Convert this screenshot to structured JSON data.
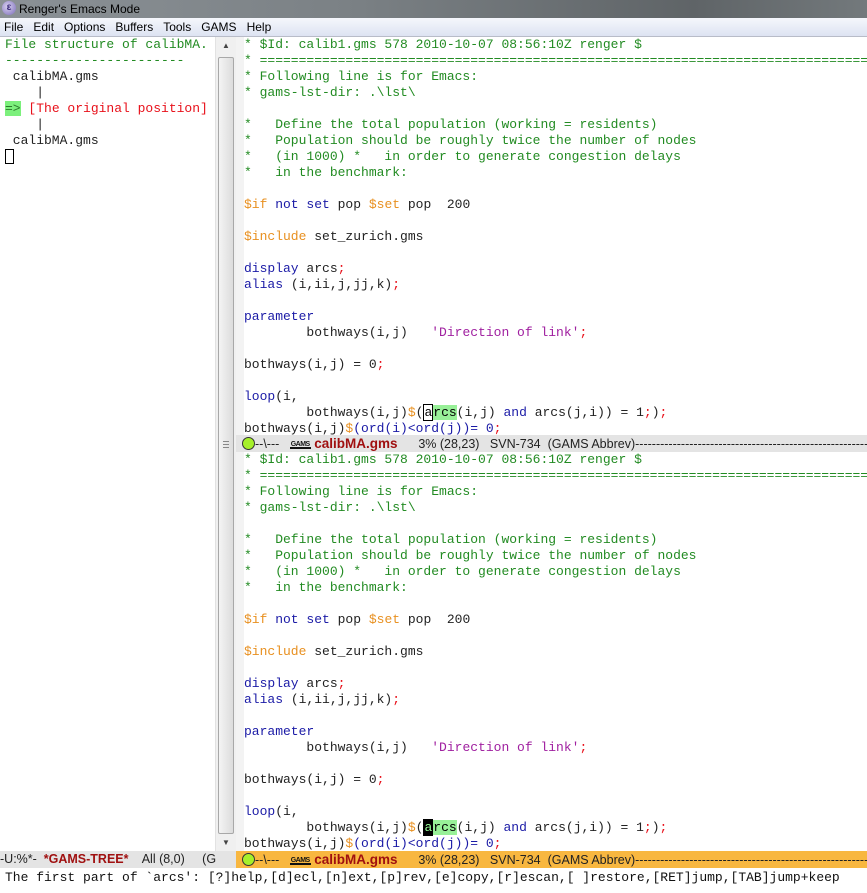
{
  "window": {
    "title": "Renger's Emacs Mode",
    "app_icon": "emacs-icon"
  },
  "menu": [
    "File",
    "Edit",
    "Options",
    "Buffers",
    "Tools",
    "GAMS",
    "Help"
  ],
  "tree": {
    "header": "File structure of calibMA.",
    "rule": "-----------------------",
    "items": [
      {
        "text": " calibMA.gms"
      },
      {
        "text": "    |"
      },
      {
        "marker": "=>",
        "text": " [The original position]"
      },
      {
        "text": "    |"
      },
      {
        "text": " calibMA.gms"
      }
    ]
  },
  "code_lines": [
    [
      {
        "t": "* $Id: calib1.gms 578 2010-10-07 08:56:10Z renger $",
        "c": "cmt"
      }
    ],
    [
      {
        "t": "* =======================================================================================",
        "c": "cmt"
      }
    ],
    [
      {
        "t": "* Following line is for Emacs:",
        "c": "cmt"
      }
    ],
    [
      {
        "t": "* gams-lst-dir: .\\lst\\",
        "c": "cmt"
      }
    ],
    [
      {
        "t": "",
        "c": "plain"
      }
    ],
    [
      {
        "t": "*   Define the total population (working = residents)",
        "c": "cmt"
      }
    ],
    [
      {
        "t": "*   Population should be roughly twice the number of nodes",
        "c": "cmt"
      }
    ],
    [
      {
        "t": "*   (in 1000) *   in order to generate congestion delays",
        "c": "cmt"
      }
    ],
    [
      {
        "t": "*   in the benchmark:",
        "c": "cmt"
      }
    ],
    [
      {
        "t": "",
        "c": "plain"
      }
    ],
    [
      {
        "t": "$if",
        "c": "dir"
      },
      {
        "t": " not set",
        "c": "kw"
      },
      {
        "t": " pop ",
        "c": "plain"
      },
      {
        "t": "$set",
        "c": "dir"
      },
      {
        "t": " pop  200",
        "c": "plain"
      }
    ],
    [
      {
        "t": "",
        "c": "plain"
      }
    ],
    [
      {
        "t": "$include",
        "c": "dir"
      },
      {
        "t": " set_zurich.gms",
        "c": "plain"
      }
    ],
    [
      {
        "t": "",
        "c": "plain"
      }
    ],
    [
      {
        "t": "display",
        "c": "kw"
      },
      {
        "t": " arcs",
        "c": "plain"
      },
      {
        "t": ";",
        "c": "semi"
      }
    ],
    [
      {
        "t": "alias",
        "c": "kw"
      },
      {
        "t": " (i,ii,j,jj,k)",
        "c": "plain"
      },
      {
        "t": ";",
        "c": "semi"
      }
    ],
    [
      {
        "t": "",
        "c": "plain"
      }
    ],
    [
      {
        "t": "parameter",
        "c": "kw"
      }
    ],
    [
      {
        "t": "        bothways(i,j)   ",
        "c": "plain"
      },
      {
        "t": "'Direction of link'",
        "c": "str"
      },
      {
        "t": ";",
        "c": "semi"
      }
    ],
    [
      {
        "t": "",
        "c": "plain"
      }
    ],
    [
      {
        "t": "bothways(i,j) = 0",
        "c": "plain"
      },
      {
        "t": ";",
        "c": "semi"
      }
    ],
    [
      {
        "t": "",
        "c": "plain"
      }
    ],
    [
      {
        "t": "loop",
        "c": "kw"
      },
      {
        "t": "(i,",
        "c": "plain"
      }
    ],
    [
      {
        "t": "        bothways(i,j)",
        "c": "plain"
      },
      {
        "t": "$",
        "c": "dir"
      },
      {
        "t": "(",
        "c": "plain"
      },
      {
        "t": "a",
        "c": "cursor"
      },
      {
        "t": "rcs",
        "c": "match"
      },
      {
        "t": "(i,j) ",
        "c": "plain"
      },
      {
        "t": "and",
        "c": "kw"
      },
      {
        "t": " arcs(j,i)) = 1",
        "c": "plain"
      },
      {
        "t": ";",
        "c": "semi"
      },
      {
        "t": ")",
        "c": "plain"
      },
      {
        "t": ";",
        "c": "semi"
      }
    ],
    [
      {
        "t": "bothways(i,j)",
        "c": "plain"
      },
      {
        "t": "$",
        "c": "dir"
      },
      {
        "t": "(ord(i)<ord(j))= 0",
        "c": "kw"
      },
      {
        "t": ";",
        "c": "semi"
      }
    ]
  ],
  "modeline_upper": {
    "status": "--\\---",
    "mode_icon": "GAMS",
    "buffer": "calibMA.gms",
    "position": "3% (28,23)",
    "vc": "SVN-734",
    "modes": "(GAMS Abbrev)"
  },
  "modeline_lower": {
    "status": "--\\---",
    "mode_icon": "GAMS",
    "buffer": "calibMA.gms",
    "position": "3% (28,23)",
    "vc": "SVN-734",
    "modes": "(GAMS Abbrev)"
  },
  "modeline_tree": {
    "status": "-U:%*-",
    "buffer": "*GAMS-TREE*",
    "position": "All (8,0)",
    "modes": "(G"
  },
  "minibuffer": "The first part of `arcs': [?]help,[d]ecl,[n]ext,[p]rev,[e]copy,[r]escan,[ ]restore,[RET]jump,[TAB]jump+keep",
  "colors": {
    "comment": "#228b22",
    "keyword": "#1a1aa6",
    "directive": "#e89020",
    "string": "#a020a0",
    "semicolon": "#e8101a",
    "active_modeline": "#f8b740",
    "inactive_modeline": "#e4e4e4",
    "match_highlight": "#98f098"
  }
}
